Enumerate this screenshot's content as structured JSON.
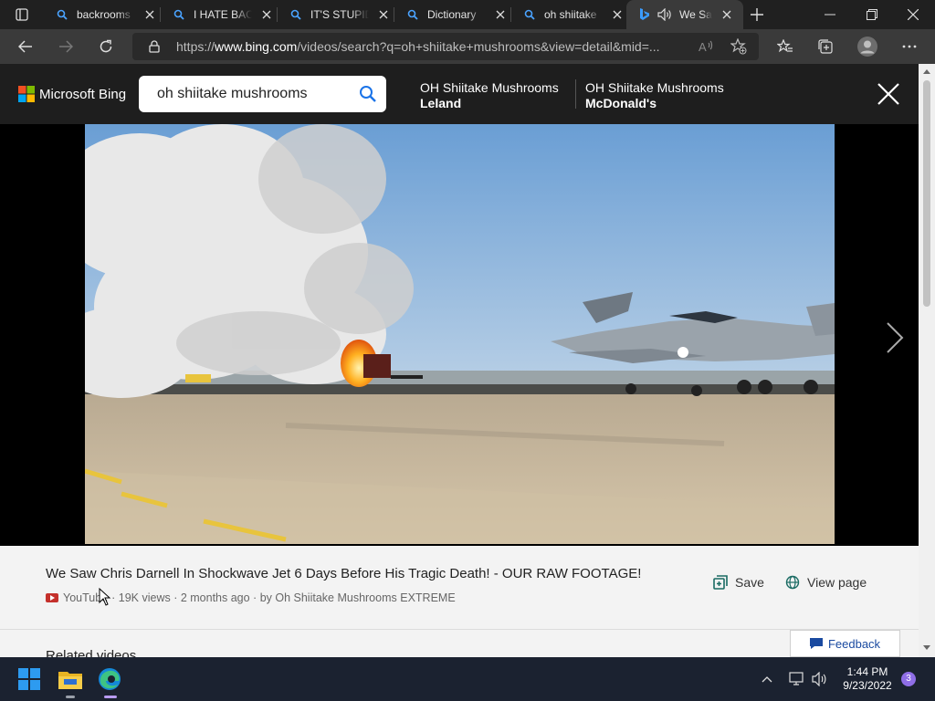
{
  "browser": {
    "tabs": [
      {
        "title": "backrooms",
        "icon": "search-icon"
      },
      {
        "title": "I HATE BACK",
        "icon": "search-icon"
      },
      {
        "title": "IT'S STUPID",
        "icon": "search-icon"
      },
      {
        "title": "Dictionary",
        "icon": "search-icon"
      },
      {
        "title": "oh shiitake",
        "icon": "search-icon"
      },
      {
        "title": "We Sa",
        "icon": "bing-icon",
        "active": true
      }
    ],
    "url_prefix": "https://",
    "url_domain": "www.bing.com",
    "url_rest": "/videos/search?q=oh+shiitake+mushrooms&view=detail&mid=..."
  },
  "bing": {
    "logo_text": "Microsoft Bing",
    "search_query": "oh shiitake mushrooms",
    "related": [
      {
        "line1": "OH Shiitake Mushrooms",
        "line2": "Leland"
      },
      {
        "line1": "OH Shiitake Mushrooms",
        "line2": "McDonald's"
      }
    ]
  },
  "video": {
    "title": "We Saw Chris Darnell In Shockwave Jet 6 Days Before His Tragic Death! - OUR RAW FOOTAGE!",
    "source": "YouTube",
    "meta": "· 19K views · 2 months ago · by Oh Shiitake Mushrooms EXTREME",
    "save_label": "Save",
    "view_page_label": "View page",
    "related_heading": "Related videos",
    "feedback_label": "Feedback"
  },
  "taskbar": {
    "time": "1:44 PM",
    "date": "9/23/2022",
    "notifications": "3"
  },
  "colors": {
    "accent": "#1a73e8",
    "taskbar": "#1b2230",
    "tab_bg": "#202020",
    "toolbar_bg": "#3a3a3a"
  }
}
